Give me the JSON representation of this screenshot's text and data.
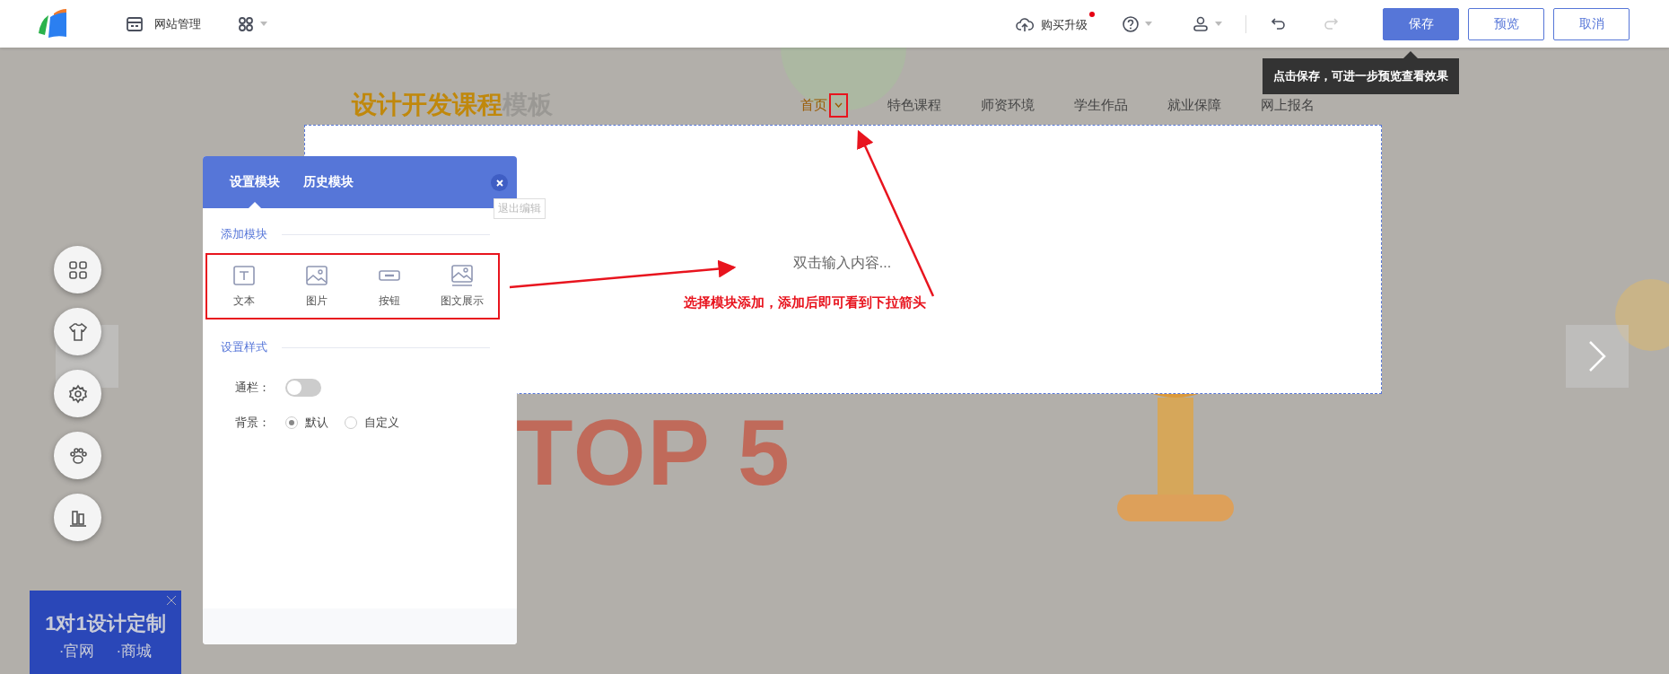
{
  "topbar": {
    "menu": "网站管理",
    "upgrade": {
      "label": "购买升级",
      "dot": true
    },
    "history": [
      {
        "kind": "undo",
        "disabled": false
      },
      {
        "kind": "redo",
        "disabled": true
      }
    ],
    "buttons": [
      {
        "label": "保存",
        "kind": "primary"
      },
      {
        "label": "预览",
        "kind": "outline"
      },
      {
        "label": "取消",
        "kind": "outline"
      }
    ],
    "save_tip": "点击保存，可进一步预览查看效果"
  },
  "site": {
    "title": [
      {
        "text": "设计开发课程",
        "color": "#c0880c"
      },
      {
        "text": "模板",
        "color": "#9a9894"
      }
    ],
    "nav": [
      {
        "label": "首页",
        "selected": true
      },
      {
        "label": "特色课程",
        "selected": false
      },
      {
        "label": "师资环境",
        "selected": false
      },
      {
        "label": "学生作品",
        "selected": false
      },
      {
        "label": "就业保障",
        "selected": false
      },
      {
        "label": "网上报名",
        "selected": false
      }
    ],
    "block_hint": "双击输入内容...",
    "banner_text": "TOP 5"
  },
  "panel": {
    "tabs": [
      {
        "label": "设置模块",
        "selected": true
      },
      {
        "label": "历史模块",
        "selected": false
      }
    ],
    "close_tip": "退出编辑",
    "add_title": "添加模块",
    "modules": [
      {
        "label": "文本",
        "kind": "text"
      },
      {
        "label": "图片",
        "kind": "image"
      },
      {
        "label": "按钮",
        "kind": "button"
      },
      {
        "label": "图文展示",
        "kind": "image-text"
      }
    ],
    "style_title": "设置样式",
    "full_width": {
      "label": "通栏：",
      "on": false
    },
    "background": {
      "label": "背景：",
      "options": [
        {
          "label": "默认",
          "selected": true
        },
        {
          "label": "自定义",
          "selected": false
        }
      ]
    }
  },
  "annotation": "选择模块添加，添加后即可看到下拉箭头",
  "side_tools": [
    {
      "kind": "grid"
    },
    {
      "kind": "shirt"
    },
    {
      "kind": "gear"
    },
    {
      "kind": "paw"
    },
    {
      "kind": "building"
    }
  ],
  "ad": {
    "title": "1对1设计定制",
    "links": [
      "·官网",
      "·商城"
    ]
  }
}
